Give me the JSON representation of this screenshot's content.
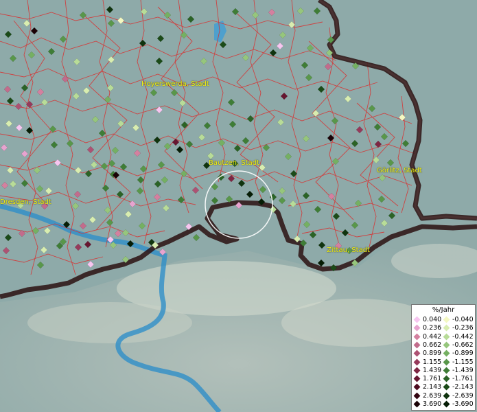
{
  "map": {
    "city_labels": [
      {
        "name": "Hoyerswerda, Stadt"
      },
      {
        "name": "Bautzen, Stadt"
      },
      {
        "name": "Görlitz, Stadt"
      },
      {
        "name": "Dresden, Stadt"
      },
      {
        "name": "Zittau, Stadt"
      }
    ]
  },
  "legend": {
    "title": "%/Jahr",
    "positive_values": [
      "0.040",
      "0.236",
      "0.442",
      "0.662",
      "0.899",
      "1.155",
      "1.439",
      "1.761",
      "2.143",
      "2.639",
      "3.690"
    ],
    "negative_values": [
      "-0.040",
      "-0.236",
      "-0.442",
      "-0.662",
      "-0.899",
      "-1.155",
      "-1.439",
      "-1.761",
      "-2.143",
      "-2.639",
      "-3.690"
    ],
    "positive_colors": [
      "#f7c6f0",
      "#e7a3cf",
      "#d4809f",
      "#c26c8c",
      "#ad5273",
      "#963a5b",
      "#7e2643",
      "#671630",
      "#4d0a1e",
      "#330510",
      "#1a0206"
    ],
    "negative_colors": [
      "#f4f8c2",
      "#d8edb0",
      "#b8dc98",
      "#96c67c",
      "#75b062",
      "#59974a",
      "#3f7d36",
      "#2b6326",
      "#1b4b18",
      "#10340e",
      "#061d05"
    ]
  },
  "colors": {
    "border": "#3a1a1a",
    "district_lines": "#d93030",
    "river": "#2f8fc8",
    "city_label": "#f2f21a",
    "highlight_circle": "#ffffff"
  }
}
